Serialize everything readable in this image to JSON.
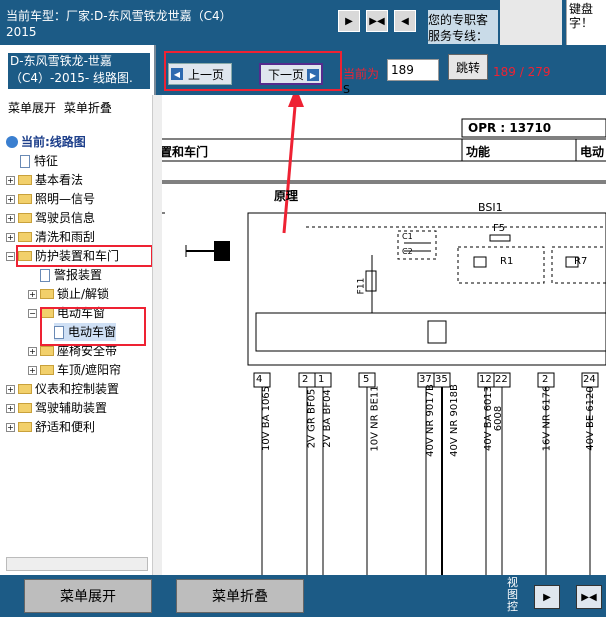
{
  "header": {
    "car_model": "当前车型：厂家:D-东风雪铁龙世嘉（C4）2015",
    "service_line1": "您的专职客",
    "service_line2": "服务专线：",
    "top_note": "键盘字！"
  },
  "toolbar": {
    "prev_label": "上一页",
    "next_label": "下一页",
    "current_label": "当前为",
    "current_label2": "S",
    "page_value": "189",
    "jump_label": "跳转",
    "page_count": "189 / 279"
  },
  "sidebar": {
    "car_title": "D-东风雪铁龙-世嘉（C4）-2015- 线路图.",
    "expand_label": "菜单展开",
    "collapse_label": "菜单折叠",
    "tree": [
      {
        "label": "当前:线路图",
        "type": "root"
      },
      {
        "label": "特征",
        "type": "doc"
      },
      {
        "label": "基本看法",
        "type": "folder"
      },
      {
        "label": "照明—信号",
        "type": "folder"
      },
      {
        "label": "驾驶员信息",
        "type": "folder"
      },
      {
        "label": "清洗和雨刮",
        "type": "folder"
      },
      {
        "label": "防护装置和车门",
        "type": "folder-open"
      },
      {
        "label": "警报装置",
        "type": "doc"
      },
      {
        "label": "锁止/解锁",
        "type": "folder"
      },
      {
        "label": "电动车窗",
        "type": "folder-open"
      },
      {
        "label": "电动车窗",
        "type": "doc-selected"
      },
      {
        "label": "座椅安全带",
        "type": "folder"
      },
      {
        "label": "车顶/遮阳帘",
        "type": "folder"
      },
      {
        "label": "仪表和控制装置",
        "type": "folder"
      },
      {
        "label": "驾驶辅助装置",
        "type": "folder"
      },
      {
        "label": "舒适和便利",
        "type": "folder"
      }
    ]
  },
  "diagram": {
    "opr": "OPR : 13710",
    "section_left": "置和车门",
    "section_func": "功能",
    "section_right": "电动",
    "principle": "原理",
    "bsi": "BSI1",
    "c1": "C1",
    "c2": "C2",
    "f5": "F5",
    "r1": "R1",
    "r7": "R7",
    "f11": "F11",
    "pins": [
      "4",
      "2",
      "1",
      "5",
      "37",
      "35",
      "12",
      "22",
      "2",
      "24"
    ],
    "wires": [
      "10V BA 1065",
      "2V GR BF05",
      "2V BA BF04",
      "10V NR BE11",
      "40V NR 9017B",
      "40V NR 9018B",
      "40V BA 6013",
      "6008",
      "16V NR 6176",
      "40V BE 6120"
    ]
  },
  "footer": {
    "expand_button": "菜单展开",
    "collapse_button": "菜单折叠",
    "view_label": "视图控"
  }
}
